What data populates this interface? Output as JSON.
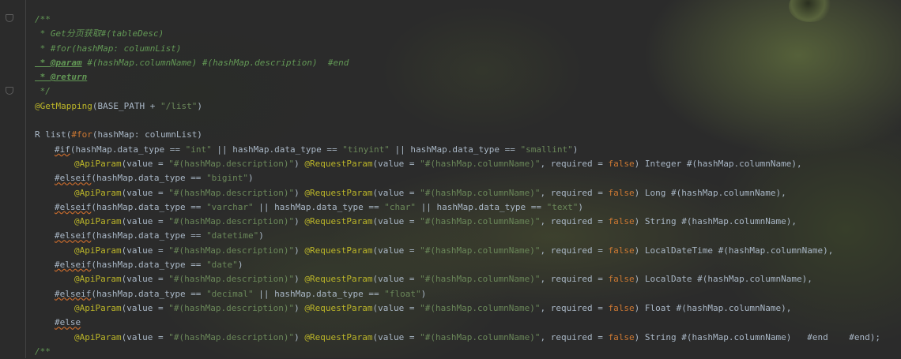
{
  "code": {
    "l1": "/**",
    "l2": " * Get分页获取#(tableDesc)",
    "l3": " * #for(hashMap: columnList)",
    "l4_tag": " * @param",
    "l4_rest": " #(hashMap.columnName) #(hashMap.description)  #end",
    "l5_tag": " * @return",
    "l6": " */",
    "l7_ann": "@GetMapping",
    "l7_a": "(BASE_PATH + ",
    "l7_str": "\"/list\"",
    "l7_b": ")",
    "l9_a": "R list(",
    "l9_for": "#for",
    "l9_b": "(hashMap: columnList)",
    "if_kw": "#if",
    "if_a": "(hashMap.data_type == ",
    "if_s1": "\"int\"",
    "if_b": " || hashMap.data_type == ",
    "if_s2": "\"tinyint\"",
    "if_c": " || hashMap.data_type == ",
    "if_s3": "\"smallint\"",
    "if_d": ")",
    "p_ann": "@ApiParam",
    "p_a": "(value = ",
    "p_desc": "\"#(hashMap.description)\"",
    "p_b": ") ",
    "p_ann2": "@RequestParam",
    "p_c": "(value = ",
    "p_col": "\"#(hashMap.columnName)\"",
    "p_d": ", required = ",
    "p_false": "false",
    "p_e": ") ",
    "t_integer": "Integer",
    "t_long": "Long",
    "t_string": "String",
    "t_localdatetime": "LocalDateTime",
    "t_localdate": "LocalDate",
    "t_float": "Float",
    "p_name": " #(hashMap.columnName),",
    "p_name_last": " #(hashMap.columnName)   #end    #end);",
    "elseif_kw": "#elseif",
    "ei_a": "(hashMap.data_type == ",
    "ei_bigint": "\"bigint\"",
    "ei_close": ")",
    "ei_varchar": "\"varchar\"",
    "ei_or": " || hashMap.data_type == ",
    "ei_char": "\"char\"",
    "ei_text": "\"text\"",
    "ei_datetime": "\"datetime\"",
    "ei_date": "\"date\"",
    "ei_decimal": "\"decimal\"",
    "ei_float": "\"float\"",
    "else_kw": "#else",
    "last": "/**"
  },
  "colors": {
    "background": "#2b2b2b",
    "text": "#a9b7c6",
    "comment": "#629755",
    "annotation": "#bbb529",
    "string": "#6a8759",
    "keyword": "#cc7832"
  }
}
